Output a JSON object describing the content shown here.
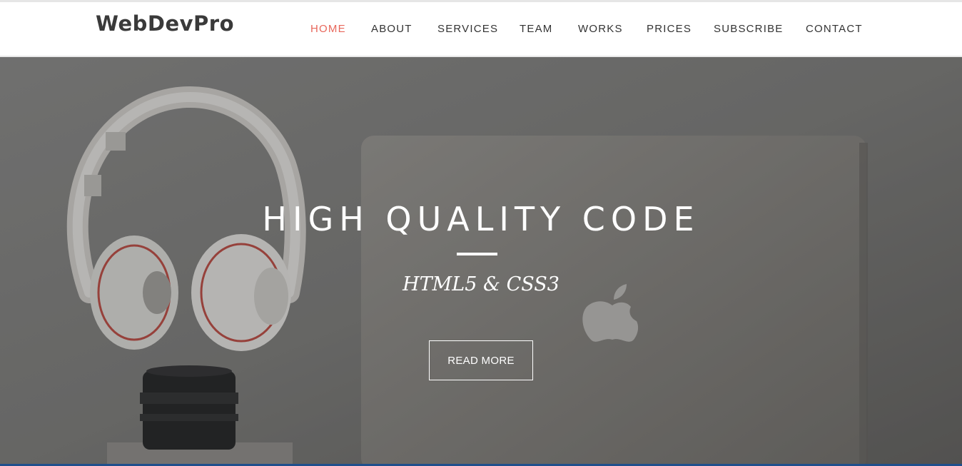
{
  "header": {
    "brand": "WebDevPro",
    "nav": [
      {
        "label": "HOME",
        "active": true
      },
      {
        "label": "ABOUT"
      },
      {
        "label": "SERVICES"
      },
      {
        "label": "TEAM"
      },
      {
        "label": "WORKS"
      },
      {
        "label": "PRICES"
      },
      {
        "label": "SUBSCRIBE"
      },
      {
        "label": "CONTACT"
      }
    ]
  },
  "hero": {
    "title": "HIGH QUALITY CODE",
    "subtitle": "HTML5 & CSS3",
    "button_label": "READ MORE"
  },
  "colors": {
    "accent": "#e8675b",
    "nav_text": "#333333",
    "brand_text": "#3a3a3a",
    "bottom_bar": "#1f4f8c"
  },
  "icons": {
    "hero_image": "headphones-camera-laptop-photo",
    "laptop_logo": "apple-logo-icon"
  }
}
